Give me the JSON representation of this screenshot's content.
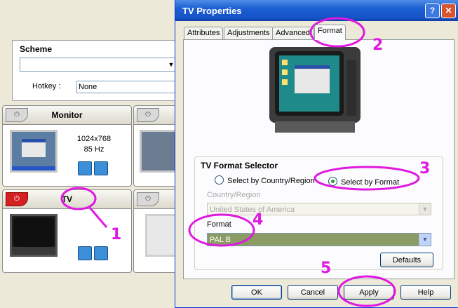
{
  "left_panel": {
    "scheme_label": "Scheme",
    "scheme_value": "",
    "hotkey_label": "Hotkey :",
    "hotkey_value": "None",
    "devices": [
      {
        "name": "Monitor",
        "resolution": "1024x768",
        "refresh": "85 Hz",
        "powered": false
      },
      {
        "name": "TV",
        "powered": true
      }
    ]
  },
  "dialog": {
    "title": "TV Properties",
    "help_glyph": "?",
    "close_glyph": "✕",
    "tabs": [
      "Attributes",
      "Adjustments",
      "Advanced",
      "Format"
    ],
    "active_tab": "Format",
    "group_title": "TV Format Selector",
    "radio_country": "Select by Country/Region",
    "radio_format": "Select by Format",
    "selected_radio": "format",
    "country_label": "Country/Region",
    "country_value": "United States of America",
    "format_label": "Format",
    "format_value": "PAL B",
    "defaults_button": "Defaults",
    "buttons": {
      "ok": "OK",
      "cancel": "Cancel",
      "apply": "Apply",
      "help": "Help"
    }
  },
  "annotations": [
    "1",
    "2",
    "3",
    "4",
    "5"
  ],
  "colors": {
    "annotation": "#e018e0",
    "titlebar": "#1553c6",
    "format_select_bg": "#8a9b63"
  }
}
